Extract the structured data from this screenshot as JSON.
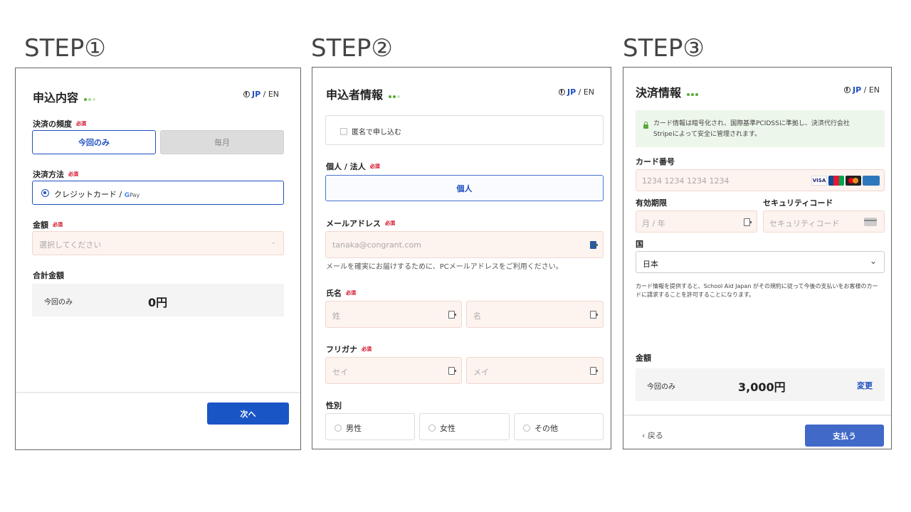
{
  "steps": [
    "STEP①",
    "STEP②",
    "STEP③"
  ],
  "colors": {
    "accent": "#1a55c6",
    "required": "#d0021b",
    "dot_green": "#5aa83a"
  },
  "lang": {
    "jp": "JP",
    "sep": " / ",
    "en": "EN"
  },
  "required_label": "必須",
  "step1": {
    "title": "申込内容",
    "frequency_label": "決済の頻度",
    "once_label": "今回のみ",
    "monthly_label": "毎月",
    "method_label": "決済方法",
    "method_option": "クレジットカード / ",
    "gpay_g": "G",
    "gpay_text": "Pay",
    "amount_label": "金額",
    "amount_placeholder": "選択してください",
    "total_label": "合計金額",
    "total_freq": "今回のみ",
    "total_value": "0円",
    "next_button": "次へ"
  },
  "step2": {
    "title": "申込者情報",
    "anonymous_label": "匿名で申し込む",
    "type_label": "個人 / 法人",
    "type_value": "個人",
    "email_label": "メールアドレス",
    "email_placeholder": "tanaka@congrant.com",
    "email_hint": "メールを確実にお届けするために、PCメールアドレスをご利用ください。",
    "name_label": "氏名",
    "last_name_placeholder": "姓",
    "first_name_placeholder": "名",
    "furigana_label": "フリガナ",
    "sei_placeholder": "セイ",
    "mei_placeholder": "メイ",
    "gender_label": "性別",
    "genders": [
      "男性",
      "女性",
      "その他"
    ]
  },
  "step3": {
    "title": "決済情報",
    "secure_notice_1": "カード情報は暗号化され、国際基準PCIDSSに準拠し、決済代行会社",
    "secure_notice_2": "Stripeによって安全に管理されます。",
    "card_number_label": "カード番号",
    "card_number_placeholder": "1234 1234 1234 1234",
    "card_brands": [
      "VISA",
      "JCB",
      "Mastercard",
      "AMEX"
    ],
    "visa_text": "VISA",
    "jcb_text": "JCB",
    "expiry_label": "有効期限",
    "expiry_placeholder": "月 / 年",
    "cvc_label": "セキュリティコード",
    "cvc_placeholder": "セキュリティコード",
    "country_label": "国",
    "country_value": "日本",
    "terms_1": "カード情報を提供すると、School Aid Japan がその規約に従って今後の支払いをお客様のカー",
    "terms_2": "ドに請求することを許可することになります。",
    "amount_label": "金額",
    "amount_freq": "今回のみ",
    "amount_value": "3,000円",
    "change_link": "変更",
    "back_button": "戻る",
    "pay_button": "支払う"
  }
}
